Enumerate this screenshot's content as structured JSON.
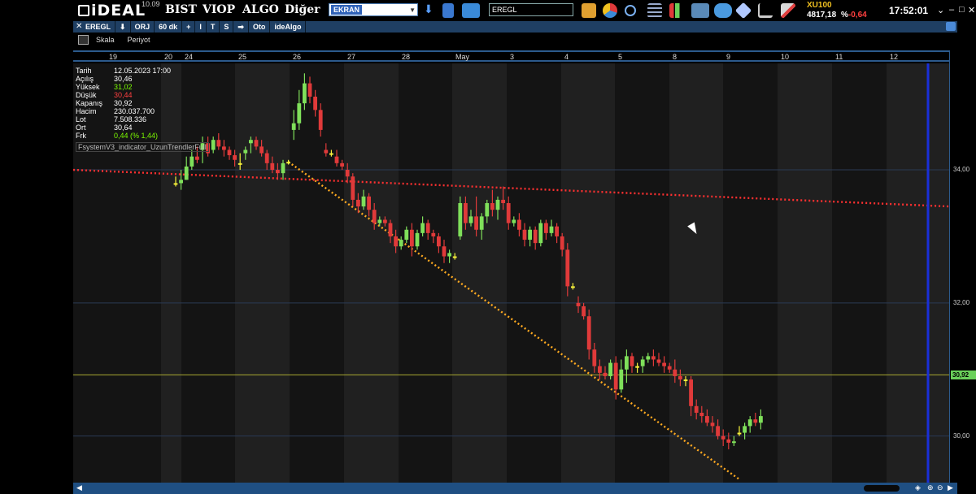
{
  "app": {
    "logo": "iDEAL",
    "version": "10.09",
    "menu": [
      "BIST",
      "VIOP",
      "ALGO",
      "Diğer"
    ],
    "screen_select": "EKRAN",
    "symbol_input": "EREGL",
    "index": {
      "name": "XU100",
      "value": "4817,18",
      "pct_label": "%",
      "pct": "-0,64"
    },
    "clock": "17:52:01",
    "window_buttons": [
      "⌄",
      "–",
      "□",
      "✕"
    ]
  },
  "toolbar_icons": [
    "download-icon",
    "document-icon",
    "monitor-icon",
    "note-icon",
    "pie-chart-icon",
    "search-icon",
    "list-icon",
    "candles-icon",
    "news-icon",
    "cloud-icon",
    "cube-icon",
    "cart-icon",
    "tools-icon"
  ],
  "chart_toolbar": {
    "items": [
      "EREGL",
      "⬇",
      "ORJ",
      "60 dk",
      "+",
      "I",
      "T",
      "S",
      "➡",
      "Oto",
      "ideAlgo"
    ]
  },
  "subbar": {
    "scale": "Skala",
    "period": "Periyot"
  },
  "info_panel": {
    "rows": [
      {
        "k": "Tarih",
        "v": "12.05.2023 17:00",
        "color": "#ffffff"
      },
      {
        "k": "Açılış",
        "v": "30,46",
        "color": "#ffffff"
      },
      {
        "k": "Yüksek",
        "v": "31,02",
        "color": "#7CFC00"
      },
      {
        "k": "Düşük",
        "v": "30,44",
        "color": "#ff4040"
      },
      {
        "k": "Kapanış",
        "v": "30,92",
        "color": "#ffffff"
      },
      {
        "k": "Hacim",
        "v": "230.037.700",
        "color": "#ffffff"
      },
      {
        "k": "Lot",
        "v": "7.508.336",
        "color": "#ffffff"
      },
      {
        "k": "Ort",
        "v": "30,64",
        "color": "#ffffff"
      },
      {
        "k": "Frk",
        "v": "0,44 (% 1,44)",
        "color": "#7CFC00"
      }
    ],
    "indicator": "FsystemV3_indicator_UzunTrendlerFull"
  },
  "chart_data": {
    "type": "candlestick",
    "symbol": "EREGL",
    "period": "60 dk",
    "date_labels": [
      "19",
      "20",
      "24",
      "25",
      "26",
      "27",
      "28",
      "May",
      "3",
      "4",
      "5",
      "8",
      "9",
      "10",
      "11",
      "12"
    ],
    "price_labels": [
      "34,00",
      "32,00",
      "30,00"
    ],
    "ylim": [
      29.3,
      35.6
    ],
    "current_price": "30,92",
    "colors": {
      "up": "#7fe05a",
      "down": "#e03a3a",
      "neutral": "#f5f03a",
      "dotted_red": "#ff3030",
      "dotted_orange": "#ffaa20",
      "current_line": "#a8a830",
      "cursor_line": "#1a2fd8"
    },
    "trendlines": [
      {
        "name": "red-dotted-resistance",
        "from": {
          "bar": 0,
          "price": 34.0
        },
        "to": {
          "bar": 121,
          "price": 33.45
        }
      },
      {
        "name": "orange-dotted-downtrend",
        "from": {
          "bar": 21,
          "price": 34.12
        },
        "to": {
          "bar": 105,
          "price": 29.35
        }
      }
    ],
    "candles": [
      [
        33.8,
        33.9,
        33.75,
        33.8
      ],
      [
        33.8,
        34.0,
        33.7,
        33.85
      ],
      [
        33.85,
        34.2,
        33.85,
        34.05
      ],
      [
        34.05,
        34.3,
        34.0,
        34.2
      ],
      [
        34.2,
        34.35,
        34.1,
        34.15
      ],
      [
        34.3,
        34.5,
        34.1,
        34.4
      ],
      [
        34.4,
        34.5,
        34.2,
        34.25
      ],
      [
        34.3,
        34.5,
        34.25,
        34.45
      ],
      [
        34.45,
        34.55,
        34.3,
        34.35
      ],
      [
        34.35,
        34.45,
        34.2,
        34.3
      ],
      [
        34.3,
        34.35,
        34.15,
        34.22
      ],
      [
        34.22,
        34.3,
        34.05,
        34.15
      ],
      [
        34.1,
        34.25,
        34.0,
        34.1
      ],
      [
        34.25,
        34.35,
        34.15,
        34.3
      ],
      [
        34.4,
        34.5,
        34.25,
        34.45
      ],
      [
        34.45,
        34.5,
        34.3,
        34.35
      ],
      [
        34.35,
        34.45,
        34.2,
        34.25
      ],
      [
        34.25,
        34.3,
        34.0,
        34.1
      ],
      [
        34.1,
        34.2,
        33.95,
        34.0
      ],
      [
        34.0,
        34.1,
        33.85,
        33.95
      ],
      [
        33.95,
        34.15,
        33.85,
        34.1
      ],
      [
        34.12,
        34.15,
        34.08,
        34.12
      ],
      [
        34.6,
        34.9,
        34.45,
        34.7
      ],
      [
        34.7,
        35.2,
        34.6,
        35.0
      ],
      [
        35.0,
        35.45,
        34.9,
        35.3
      ],
      [
        35.3,
        35.4,
        35.0,
        35.1
      ],
      [
        35.1,
        35.2,
        34.8,
        34.9
      ],
      [
        34.9,
        35.0,
        34.5,
        34.6
      ],
      [
        34.3,
        34.4,
        34.2,
        34.25
      ],
      [
        34.25,
        34.3,
        34.2,
        34.25
      ],
      [
        34.2,
        34.3,
        34.05,
        34.1
      ],
      [
        34.1,
        34.15,
        34.0,
        34.05
      ],
      [
        34.0,
        34.1,
        33.8,
        33.9
      ],
      [
        33.9,
        33.95,
        33.45,
        33.55
      ],
      [
        33.55,
        33.65,
        33.35,
        33.45
      ],
      [
        33.45,
        33.7,
        33.4,
        33.6
      ],
      [
        33.6,
        33.65,
        33.3,
        33.4
      ],
      [
        33.4,
        33.5,
        33.1,
        33.2
      ],
      [
        33.2,
        33.3,
        33.15,
        33.25
      ],
      [
        33.25,
        33.3,
        33.15,
        33.2
      ],
      [
        33.2,
        33.25,
        32.9,
        33.0
      ],
      [
        33.0,
        33.1,
        32.75,
        32.85
      ],
      [
        32.85,
        33.0,
        32.8,
        32.95
      ],
      [
        32.95,
        33.15,
        32.9,
        33.1
      ],
      [
        33.1,
        33.2,
        32.7,
        32.85
      ],
      [
        32.85,
        33.1,
        32.8,
        33.05
      ],
      [
        33.05,
        33.3,
        33.0,
        33.2
      ],
      [
        33.2,
        33.25,
        32.95,
        33.05
      ],
      [
        33.05,
        33.1,
        32.9,
        33.0
      ],
      [
        33.0,
        33.05,
        32.75,
        32.85
      ],
      [
        32.85,
        32.95,
        32.6,
        32.7
      ],
      [
        32.7,
        32.8,
        32.6,
        32.75
      ],
      [
        32.7,
        32.75,
        32.65,
        32.7
      ],
      [
        33.0,
        33.6,
        32.95,
        33.5
      ],
      [
        33.5,
        33.6,
        33.1,
        33.2
      ],
      [
        33.2,
        33.4,
        33.15,
        33.3
      ],
      [
        33.3,
        33.6,
        33.0,
        33.1
      ],
      [
        33.1,
        33.35,
        32.95,
        33.3
      ],
      [
        33.3,
        33.55,
        33.2,
        33.5
      ],
      [
        33.5,
        33.7,
        33.3,
        33.4
      ],
      [
        33.4,
        33.6,
        33.25,
        33.55
      ],
      [
        33.55,
        33.75,
        33.4,
        33.5
      ],
      [
        33.5,
        33.6,
        33.1,
        33.2
      ],
      [
        33.2,
        33.3,
        33.15,
        33.25
      ],
      [
        33.25,
        33.35,
        33.0,
        33.1
      ],
      [
        33.1,
        33.2,
        32.85,
        32.95
      ],
      [
        32.95,
        33.15,
        32.85,
        33.1
      ],
      [
        33.1,
        33.15,
        32.8,
        32.9
      ],
      [
        32.9,
        33.25,
        32.85,
        33.2
      ],
      [
        33.2,
        33.25,
        32.95,
        33.05
      ],
      [
        33.05,
        33.25,
        33.0,
        33.15
      ],
      [
        33.15,
        33.2,
        32.9,
        33.0
      ],
      [
        33.0,
        33.05,
        32.7,
        32.8
      ],
      [
        32.8,
        32.9,
        32.1,
        32.25
      ],
      [
        32.25,
        32.3,
        32.2,
        32.25
      ],
      [
        32.0,
        32.1,
        31.85,
        31.95
      ],
      [
        31.95,
        32.0,
        31.75,
        31.8
      ],
      [
        31.8,
        31.9,
        31.15,
        31.3
      ],
      [
        31.3,
        31.4,
        30.95,
        31.05
      ],
      [
        31.05,
        31.15,
        30.85,
        30.95
      ],
      [
        30.95,
        31.05,
        30.85,
        30.9
      ],
      [
        30.9,
        31.15,
        30.85,
        31.1
      ],
      [
        31.1,
        31.2,
        30.55,
        30.7
      ],
      [
        30.7,
        31.15,
        30.65,
        31.0
      ],
      [
        31.0,
        31.3,
        30.8,
        31.2
      ],
      [
        31.2,
        31.25,
        30.95,
        31.05
      ],
      [
        31.05,
        31.1,
        30.95,
        31.05
      ],
      [
        31.05,
        31.2,
        30.95,
        31.15
      ],
      [
        31.15,
        31.25,
        31.1,
        31.2
      ],
      [
        31.2,
        31.3,
        31.05,
        31.15
      ],
      [
        31.15,
        31.25,
        31.05,
        31.1
      ],
      [
        31.1,
        31.2,
        30.95,
        31.05
      ],
      [
        31.05,
        31.1,
        30.95,
        31.0
      ],
      [
        31.0,
        31.15,
        30.8,
        30.9
      ],
      [
        30.9,
        31.0,
        30.75,
        30.85
      ],
      [
        30.85,
        30.9,
        30.75,
        30.85
      ],
      [
        30.85,
        30.9,
        30.3,
        30.45
      ],
      [
        30.45,
        30.55,
        30.25,
        30.35
      ],
      [
        30.35,
        30.45,
        30.2,
        30.3
      ],
      [
        30.3,
        30.4,
        30.15,
        30.2
      ],
      [
        30.2,
        30.3,
        30.05,
        30.15
      ],
      [
        30.15,
        30.25,
        29.95,
        30.0
      ],
      [
        30.0,
        30.1,
        29.85,
        29.95
      ],
      [
        29.95,
        30.05,
        29.8,
        29.9
      ],
      [
        29.9,
        30.0,
        29.85,
        29.92
      ],
      [
        30.05,
        30.15,
        30.0,
        30.05
      ],
      [
        30.05,
        30.2,
        29.95,
        30.15
      ],
      [
        30.15,
        30.3,
        30.05,
        30.25
      ],
      [
        30.25,
        30.35,
        30.15,
        30.2
      ],
      [
        30.2,
        30.4,
        30.1,
        30.3
      ]
    ]
  }
}
